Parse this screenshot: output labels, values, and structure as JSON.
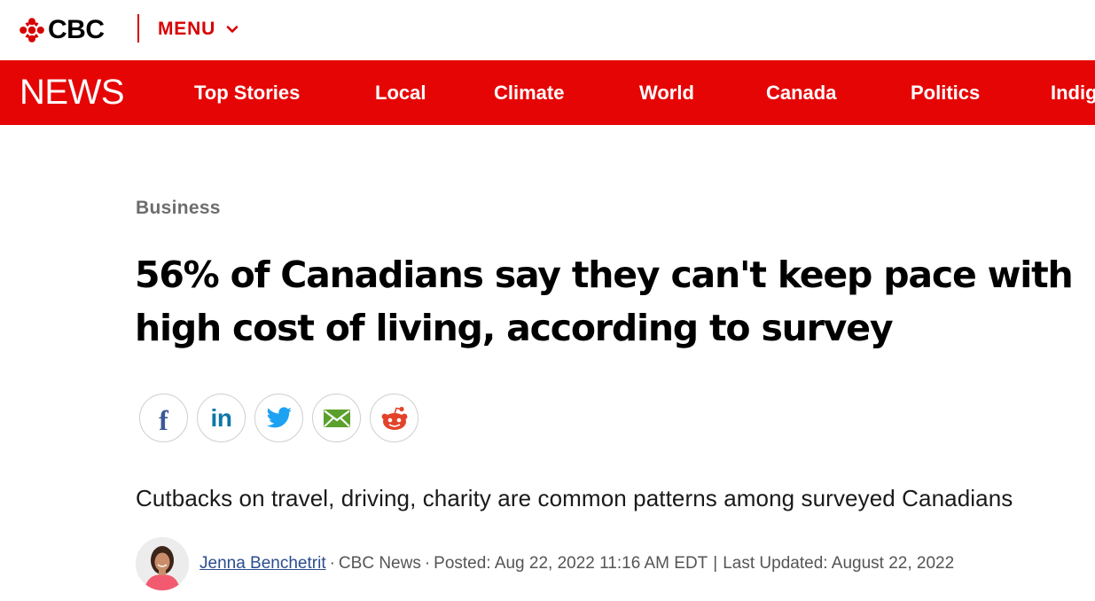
{
  "header": {
    "logo_text": "CBC",
    "menu_label": "MENU"
  },
  "nav": {
    "brand": "NEWS",
    "items": [
      {
        "label": "Top Stories"
      },
      {
        "label": "Local"
      },
      {
        "label": "Climate"
      },
      {
        "label": "World"
      },
      {
        "label": "Canada"
      },
      {
        "label": "Politics"
      },
      {
        "label": "Indigenous"
      }
    ]
  },
  "article": {
    "section": "Business",
    "headline": "56% of Canadians say they can't keep pace with high cost of living, according to survey",
    "deck": "Cutbacks on travel, driving, charity are common patterns among surveyed Canadians",
    "share": [
      {
        "icon": "facebook-icon"
      },
      {
        "icon": "linkedin-icon"
      },
      {
        "icon": "twitter-icon"
      },
      {
        "icon": "email-icon"
      },
      {
        "icon": "reddit-icon"
      }
    ],
    "byline": {
      "author": "Jenna Benchetrit",
      "outlet": "CBC News",
      "posted": "Posted: Aug 22, 2022 11:16 AM EDT",
      "updated": "Last Updated: August 22, 2022"
    }
  },
  "colors": {
    "brand_red": "#e60505",
    "menu_red": "#d80000",
    "link_blue": "#2a4d8f"
  }
}
